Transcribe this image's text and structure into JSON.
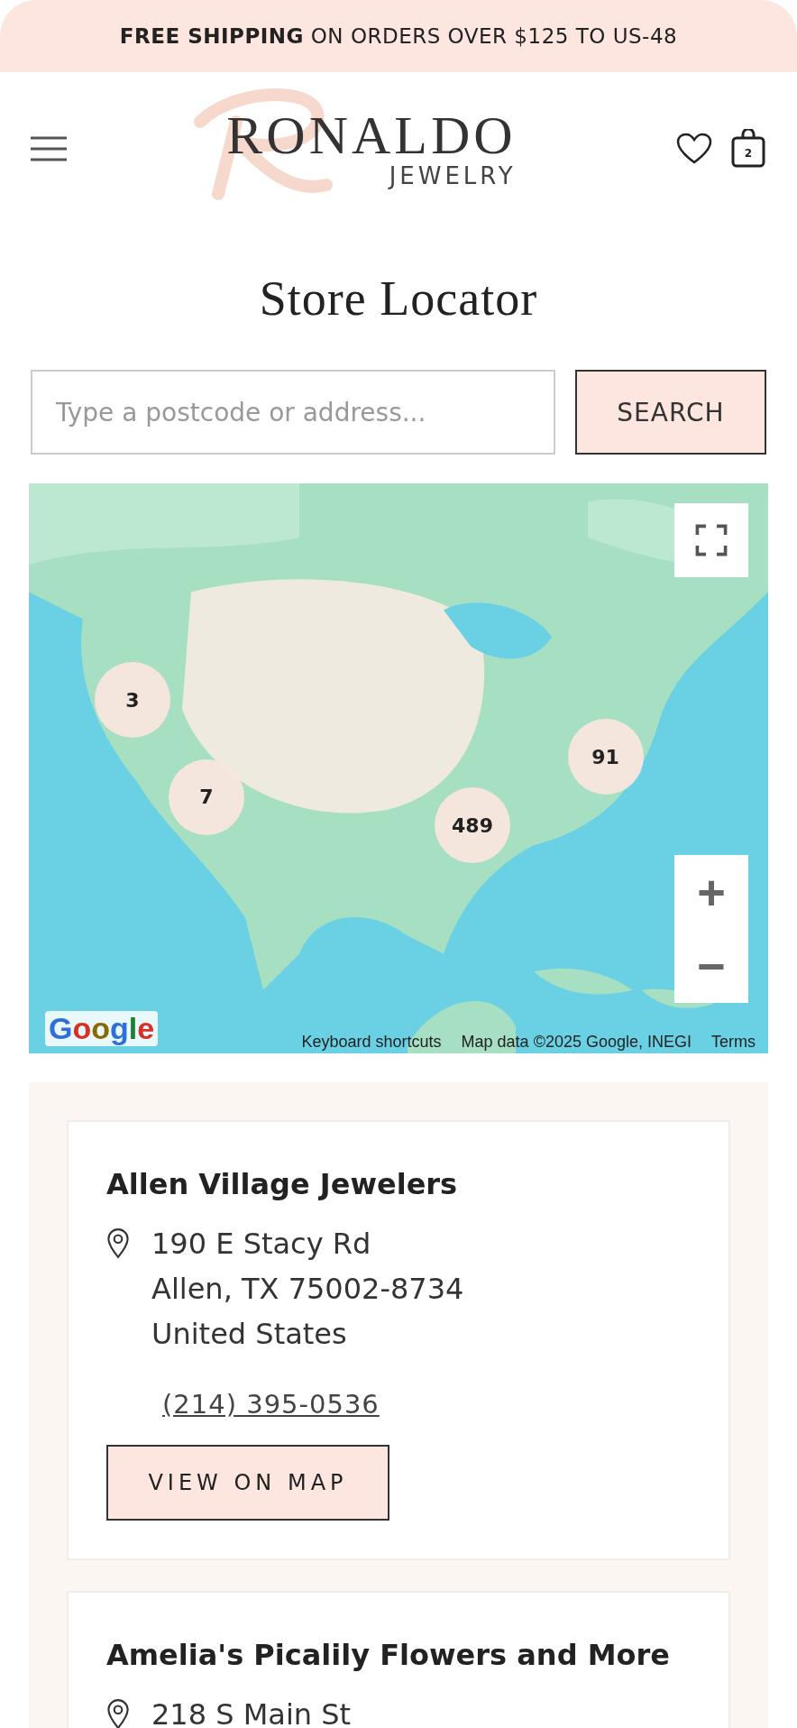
{
  "promo_bar": {
    "text": "**FREE SHIPPING** ON ORDERS OVER $125 TO US-48"
  },
  "header": {
    "logo_name": "RONALDO",
    "logo_sub": "JEWELRY",
    "cart_count": "2"
  },
  "page_title": "Store Locator",
  "search": {
    "placeholder": "Type a postcode or address...",
    "button": "SEARCH"
  },
  "map": {
    "clusters": [
      {
        "count": "3"
      },
      {
        "count": "7"
      },
      {
        "count": "489"
      },
      {
        "count": "91"
      }
    ],
    "zoom_in": "+",
    "zoom_out": "−",
    "logo": "Google",
    "attribution": [
      "Keyboard shortcuts",
      "Map data ©2025 Google, INEGI",
      "Terms"
    ]
  },
  "stores": [
    {
      "name": "Allen Village Jewelers",
      "address": [
        "190 E Stacy Rd",
        "Allen, TX 75002-8734",
        "United States"
      ],
      "phone": "(214) 395-0536",
      "button": "VIEW ON MAP"
    },
    {
      "name": "Amelia's Picalily Flowers and More",
      "address": [
        "218 S Main St"
      ]
    }
  ]
}
